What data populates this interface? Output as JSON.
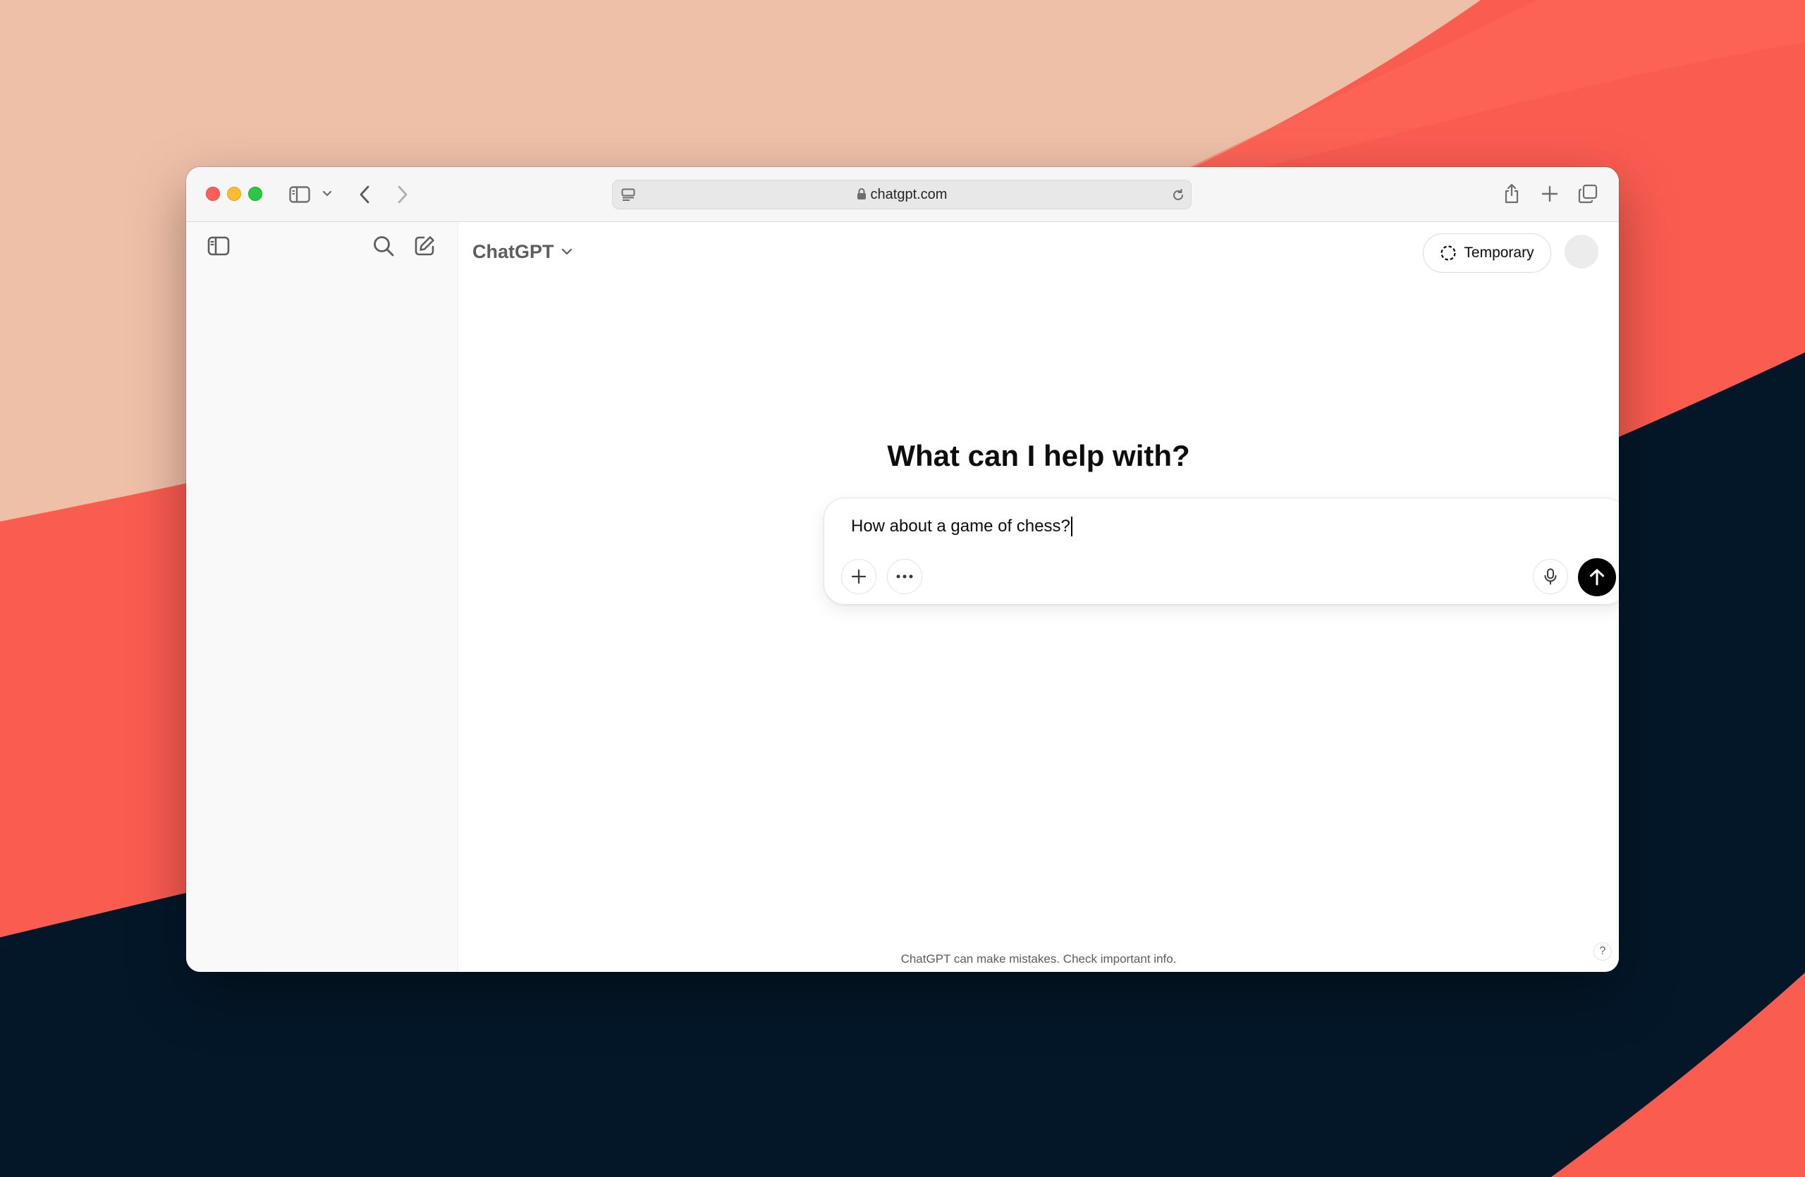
{
  "browser": {
    "url": "chatgpt.com"
  },
  "header": {
    "model_name": "ChatGPT",
    "temporary_label": "Temporary"
  },
  "main": {
    "headline": "What can I help with?",
    "composer": {
      "value": "How about a game of chess?"
    },
    "disclaimer": "ChatGPT can make mistakes. Check important info.",
    "help_label": "?"
  },
  "colors": {
    "send_button": "#000000",
    "sidebar_bg": "#f9f9f9",
    "desktop_peach": "#efc0a8",
    "desktop_coral": "#fb5c50",
    "desktop_navy": "#041729"
  },
  "icons": {
    "sidebar_toggle": "sidebar-toggle-icon",
    "search": "search-icon",
    "new_chat": "compose-icon",
    "attach": "plus-icon",
    "tools": "ellipsis-icon",
    "voice": "microphone-icon",
    "send": "arrow-up-icon"
  }
}
